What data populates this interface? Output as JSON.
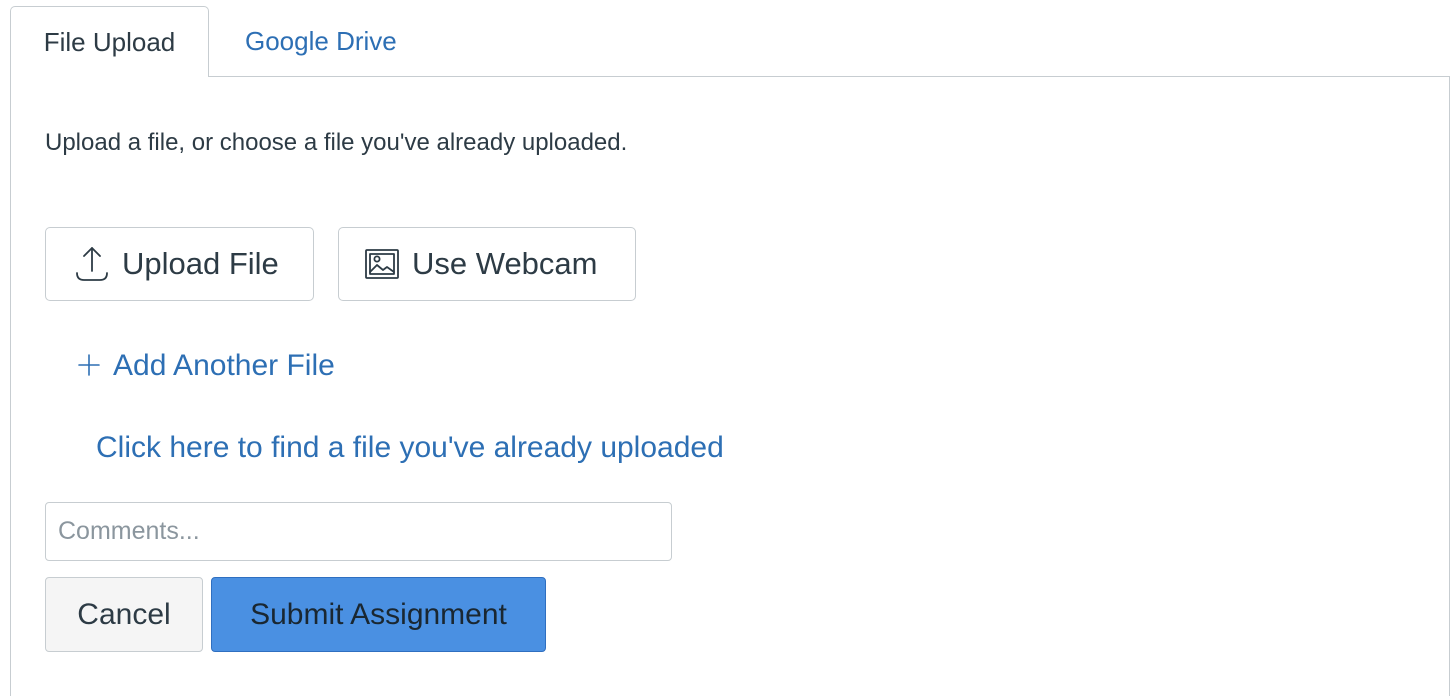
{
  "tabs": [
    {
      "label": "File Upload",
      "active": true
    },
    {
      "label": "Google Drive",
      "active": false
    }
  ],
  "intro_text": "Upload a file, or choose a file you've already uploaded.",
  "buttons": {
    "upload_file": {
      "label": "Upload File",
      "icon": "upload-icon"
    },
    "use_webcam": {
      "label": "Use Webcam",
      "icon": "image-icon"
    }
  },
  "add_file": {
    "label": "Add Another File",
    "icon": "plus-icon"
  },
  "find_link": "Click here to find a file you've already uploaded",
  "comments": {
    "placeholder": "Comments...",
    "value": ""
  },
  "actions": {
    "cancel_label": "Cancel",
    "submit_label": "Submit Assignment"
  },
  "colors": {
    "link": "#2d6fb4",
    "primary": "#4a90e2",
    "border": "#c7cdd1",
    "text": "#2d3b45"
  }
}
